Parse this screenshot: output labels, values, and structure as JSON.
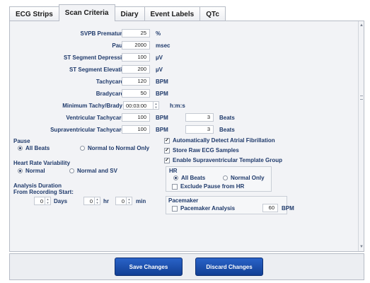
{
  "tabs": [
    "ECG Strips",
    "Scan Criteria",
    "Diary",
    "Event Labels",
    "QTc"
  ],
  "active_tab": "Scan Criteria",
  "criteria": {
    "svpb": {
      "label": "SVPB Prematurity",
      "value": "25",
      "unit": "%"
    },
    "pause": {
      "label": "Pause",
      "value": "2000",
      "unit": "msec"
    },
    "st_dep": {
      "label": "ST Segment Depression",
      "value": "100",
      "unit": "µV"
    },
    "st_elev": {
      "label": "ST Segment Elevation",
      "value": "200",
      "unit": "µV"
    },
    "tachy": {
      "label": "Tachycardia",
      "value": "120",
      "unit": "BPM"
    },
    "brady": {
      "label": "Bradycardia",
      "value": "50",
      "unit": "BPM"
    },
    "min_tb": {
      "label": "Minimum Tachy/Brady",
      "value": "00:03:00",
      "unit": "h:m:s"
    },
    "vtach": {
      "label": "Ventricular Tachycardia",
      "value": "100",
      "unit": "BPM",
      "beats": "3",
      "beats_unit": "Beats"
    },
    "svtach": {
      "label": "Supraventricular Tachycardia",
      "value": "100",
      "unit": "BPM",
      "beats": "3",
      "beats_unit": "Beats"
    }
  },
  "pause_section": {
    "title": "Pause",
    "opt1": "All Beats",
    "opt2": "Normal to Normal Only"
  },
  "hrv_section": {
    "title": "Heart Rate Variability",
    "opt1": "Normal",
    "opt2": "Normal and SV"
  },
  "analysis": {
    "title": "Analysis Duration",
    "subtitle": "From Recording Start:",
    "days": {
      "value": "0",
      "unit": "Days"
    },
    "hr": {
      "value": "0",
      "unit": "hr"
    },
    "min": {
      "value": "0",
      "unit": "min"
    }
  },
  "checks": {
    "afib": "Automatically Detect Atrial Fibrillation",
    "raw": "Store Raw ECG Samples",
    "svt_group": "Enable Supraventricular Template Group"
  },
  "hr_section": {
    "title": "HR",
    "opt1": "All Beats",
    "opt2": "Normal Only",
    "exclude": "Exclude Pause from HR"
  },
  "pacemaker": {
    "title": "Pacemaker",
    "analysis": "Pacemaker Analysis",
    "value": "60",
    "unit": "BPM"
  },
  "buttons": {
    "save": "Save Changes",
    "discard": "Discard Changes"
  },
  "colors": {
    "button": "#1f4fae",
    "label": "#1f3a6b",
    "panel": "#f2f3f6"
  }
}
